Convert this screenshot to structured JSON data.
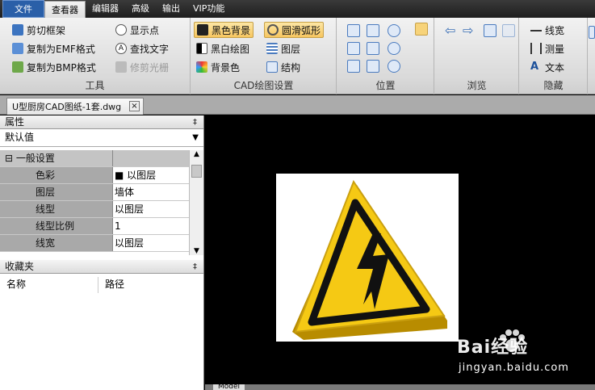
{
  "menubar": {
    "items": [
      "文件",
      "查看器",
      "编辑器",
      "高级",
      "输出",
      "VIP功能"
    ]
  },
  "ribbon": {
    "tools": {
      "label": "工具",
      "buttons": [
        "剪切框架",
        "复制为EMF格式",
        "复制为BMP格式",
        "显示点",
        "查找文字",
        "修剪光栅"
      ]
    },
    "cad_settings": {
      "label": "CAD绘图设置",
      "buttons": [
        "黑色背景",
        "黑白绘图",
        "背景色",
        "圆滑弧形",
        "图层",
        "结构"
      ]
    },
    "position": {
      "label": "位置"
    },
    "browse": {
      "label": "浏览"
    },
    "hide": {
      "label": "隐藏",
      "buttons": [
        "线宽",
        "测量",
        "文本"
      ]
    }
  },
  "doc_tab": {
    "title": "U型厨房CAD图纸-1套.dwg",
    "close": "×"
  },
  "properties": {
    "header": "属性",
    "pin": "‡",
    "combo": "默认值",
    "section": "一般设置",
    "section_toggle": "⊟",
    "rows": [
      {
        "key": "色彩",
        "value": "■ 以图层"
      },
      {
        "key": "图层",
        "value": "墙体"
      },
      {
        "key": "线型",
        "value": "以图层"
      },
      {
        "key": "线型比例",
        "value": "1"
      },
      {
        "key": "线宽",
        "value": "以图层"
      }
    ]
  },
  "favorites": {
    "header": "收藏夹",
    "pin": "‡",
    "columns": [
      "名称",
      "路径"
    ]
  },
  "model_tab": "Model",
  "watermark": {
    "main": "Bai经验",
    "sub": "jingyan.baidu.com"
  },
  "colors": {
    "accent": "#2a5fa8",
    "sign_yellow": "#f2c40f",
    "selected": "#f7c660"
  }
}
